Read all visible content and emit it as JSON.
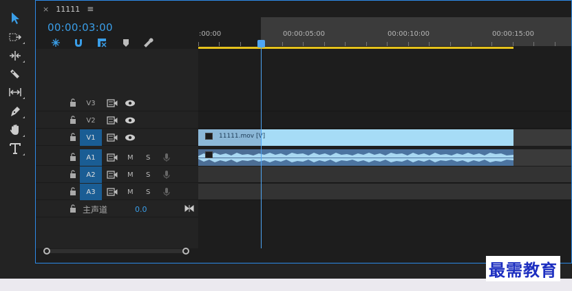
{
  "panel": {
    "tab_title": "11111",
    "tab_close": "×",
    "tab_menu": "≡",
    "timecode": "00:00:03:00"
  },
  "tools": [
    "selection-tool",
    "track-select-tool",
    "ripple-edit-tool",
    "razor-tool",
    "slip-tool",
    "pen-tool",
    "hand-tool",
    "type-tool"
  ],
  "ruler": {
    "labels": [
      ":00:00",
      "00:00:05:00",
      "00:00:10:00",
      "00:00:15:00"
    ]
  },
  "tracks": {
    "video": [
      {
        "name": "V3",
        "active": false
      },
      {
        "name": "V2",
        "active": false
      },
      {
        "name": "V1",
        "active": true
      }
    ],
    "audio": [
      {
        "name": "A1",
        "m": "M",
        "s": "S"
      },
      {
        "name": "A2",
        "m": "M",
        "s": "S"
      },
      {
        "name": "A3",
        "m": "M",
        "s": "S"
      }
    ],
    "master": {
      "label": "主声道",
      "value": "0.0"
    }
  },
  "clips": {
    "video_clip_name": "11111.mov [V]"
  },
  "watermark": "最需教育",
  "colors": {
    "accent": "#2d8ceb",
    "timecode": "#3a9ee8",
    "work_area": "#e6c21c",
    "video_clip": "#a6dcf6",
    "audio_clip": "#4c74a0"
  }
}
